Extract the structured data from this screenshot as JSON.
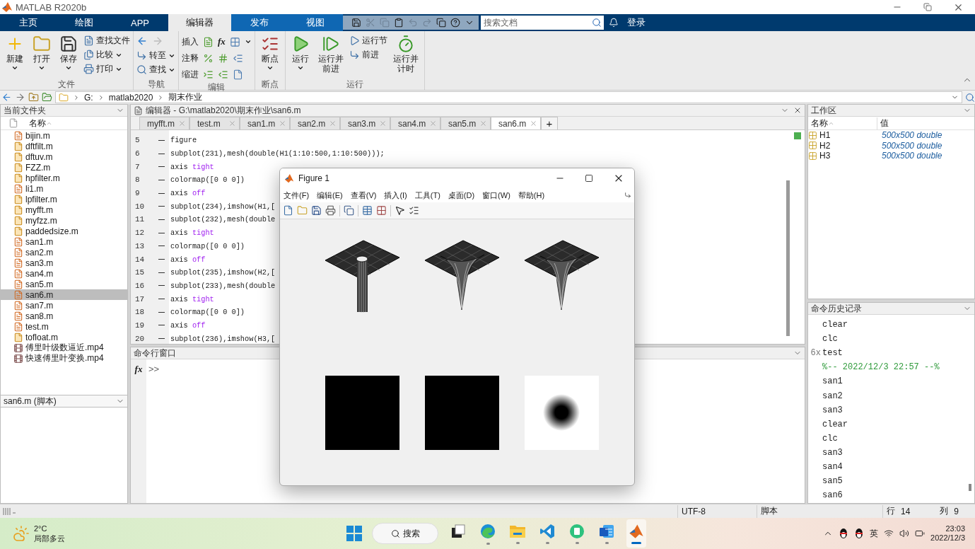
{
  "window": {
    "title": "MATLAB R2020b"
  },
  "ribbon_tabs": [
    {
      "label": "主页",
      "selected": false,
      "contextual": false
    },
    {
      "label": "绘图",
      "selected": false,
      "contextual": false
    },
    {
      "label": "APP",
      "selected": false,
      "contextual": false
    },
    {
      "label": "编辑器",
      "selected": true,
      "contextual": true
    },
    {
      "label": "发布",
      "selected": false,
      "contextual": true
    },
    {
      "label": "视图",
      "selected": false,
      "contextual": true
    }
  ],
  "quick_access": [
    {
      "enabled": true
    },
    {
      "enabled": false
    },
    {
      "enabled": false
    },
    {
      "enabled": true
    },
    {
      "enabled": false
    },
    {
      "enabled": false
    },
    {
      "enabled": true
    },
    {
      "enabled": true
    },
    {
      "enabled": true
    }
  ],
  "doc_search": {
    "placeholder": "搜索文档"
  },
  "sign_in": "登录",
  "ribbon_groups": [
    {
      "title": "文件",
      "items": [
        {
          "kind": "large",
          "label": "新建",
          "dropdown": true
        },
        {
          "kind": "large",
          "label": "打开",
          "dropdown": true
        },
        {
          "kind": "large",
          "label": "保存",
          "dropdown": true
        },
        {
          "kind": "stack",
          "buttons": [
            {
              "label": "查找文件",
              "dropdown": false
            },
            {
              "label": "比较",
              "dropdown": true
            },
            {
              "label": "打印",
              "dropdown": true
            }
          ]
        }
      ]
    },
    {
      "title": "导航",
      "items": [
        {
          "kind": "nav",
          "back_enabled": true,
          "forward_enabled": false,
          "buttons": [
            {
              "label": "转至",
              "dropdown": true
            },
            {
              "label": "查找",
              "dropdown": true
            }
          ]
        }
      ]
    },
    {
      "title": "编辑",
      "items": [
        {
          "kind": "edit_rows",
          "rows": [
            {
              "label": "插入",
              "function_button": "fx",
              "dropdown": true
            },
            {
              "label": "注释",
              "dropdown": false
            },
            {
              "label": "缩进",
              "dropdown": false
            }
          ]
        }
      ]
    },
    {
      "title": "断点",
      "items": [
        {
          "kind": "large",
          "label": "断点",
          "dropdown": true
        }
      ]
    },
    {
      "title": "运行",
      "items": [
        {
          "kind": "large",
          "label": "运行",
          "dropdown": true
        },
        {
          "kind": "large",
          "label": "运行并前进",
          "dropdown": false
        },
        {
          "kind": "stack",
          "buttons": [
            {
              "label": "运行节",
              "dropdown": false
            },
            {
              "label": "前进",
              "dropdown": false
            }
          ]
        },
        {
          "kind": "large",
          "label": "运行并计时",
          "dropdown": false
        }
      ]
    }
  ],
  "address": {
    "path": [
      "G:",
      "matlab2020",
      "期末作业"
    ]
  },
  "current_folder": {
    "title": "当前文件夹",
    "column": "名称",
    "files": [
      {
        "name": "bijin.m",
        "kind": "script",
        "selected": false
      },
      {
        "name": "dftfilt.m",
        "kind": "function",
        "selected": false
      },
      {
        "name": "dftuv.m",
        "kind": "function",
        "selected": false
      },
      {
        "name": "FZZ.m",
        "kind": "function",
        "selected": false
      },
      {
        "name": "hpfilter.m",
        "kind": "function",
        "selected": false
      },
      {
        "name": "li1.m",
        "kind": "script",
        "selected": false
      },
      {
        "name": "lpfilter.m",
        "kind": "function",
        "selected": false
      },
      {
        "name": "myfft.m",
        "kind": "function",
        "selected": false
      },
      {
        "name": "myfzz.m",
        "kind": "function",
        "selected": false
      },
      {
        "name": "paddedsize.m",
        "kind": "function",
        "selected": false
      },
      {
        "name": "san1.m",
        "kind": "script",
        "selected": false
      },
      {
        "name": "san2.m",
        "kind": "script",
        "selected": false
      },
      {
        "name": "san3.m",
        "kind": "script",
        "selected": false
      },
      {
        "name": "san4.m",
        "kind": "script",
        "selected": false
      },
      {
        "name": "san5.m",
        "kind": "script",
        "selected": false
      },
      {
        "name": "san6.m",
        "kind": "script",
        "selected": true
      },
      {
        "name": "san7.m",
        "kind": "script",
        "selected": false
      },
      {
        "name": "san8.m",
        "kind": "script",
        "selected": false
      },
      {
        "name": "test.m",
        "kind": "script",
        "selected": false
      },
      {
        "name": "tofloat.m",
        "kind": "function",
        "selected": false
      },
      {
        "name": "傅里叶级数逼近.mp4",
        "kind": "video",
        "selected": false
      },
      {
        "name": "快速傅里叶变换.mp4",
        "kind": "video",
        "selected": false
      }
    ],
    "details": "san6.m (脚本)"
  },
  "editor": {
    "title": "编辑器 - G:\\matlab2020\\期末作业\\san6.m",
    "tabs": [
      {
        "label": "myfft.m",
        "selected": false
      },
      {
        "label": "test.m",
        "selected": false
      },
      {
        "label": "san1.m",
        "selected": false
      },
      {
        "label": "san2.m",
        "selected": false
      },
      {
        "label": "san3.m",
        "selected": false
      },
      {
        "label": "san4.m",
        "selected": false
      },
      {
        "label": "san5.m",
        "selected": false
      },
      {
        "label": "san6.m",
        "selected": true
      }
    ],
    "new_tab": "+",
    "lines": [
      {
        "number": "5",
        "code": "figure"
      },
      {
        "number": "6",
        "code": "subplot(231),mesh(double(H1(1:10:500,1:10:500)));"
      },
      {
        "number": "7",
        "code": "axis",
        "keyword": "tight"
      },
      {
        "number": "8",
        "code": "colormap([0 0 0])"
      },
      {
        "number": "9",
        "code": "axis",
        "keyword": "off"
      },
      {
        "number": "10",
        "code": "subplot(234),imshow(H1,["
      },
      {
        "number": "11",
        "code": "subplot(232),mesh(double"
      },
      {
        "number": "12",
        "code": "axis",
        "keyword": "tight"
      },
      {
        "number": "13",
        "code": "colormap([0 0 0])"
      },
      {
        "number": "14",
        "code": "axis",
        "keyword": "off"
      },
      {
        "number": "15",
        "code": "subplot(235),imshow(H2,["
      },
      {
        "number": "16",
        "code": "subplot(233),mesh(double"
      },
      {
        "number": "17",
        "code": "axis",
        "keyword": "tight"
      },
      {
        "number": "18",
        "code": "colormap([0 0 0])"
      },
      {
        "number": "19",
        "code": "axis",
        "keyword": "off"
      },
      {
        "number": "20",
        "code": "subplot(236),imshow(H3,["
      }
    ]
  },
  "command_window": {
    "title": "命令行窗口",
    "function_button": "fx",
    "prompt": ">>"
  },
  "workspace": {
    "title": "工作区",
    "columns": [
      "名称",
      "值"
    ],
    "variables": [
      {
        "name": "H1",
        "value": "500x500 double"
      },
      {
        "name": "H2",
        "value": "500x500 double"
      },
      {
        "name": "H3",
        "value": "500x500 double"
      }
    ]
  },
  "history": {
    "title": "命令历史记录",
    "entries": [
      {
        "text": "clear",
        "kind": "command"
      },
      {
        "text": "clc",
        "kind": "command"
      },
      {
        "count": "6x",
        "text": "test",
        "kind": "command"
      },
      {
        "text": "%-- 2022/12/3 22:57 --%",
        "kind": "session"
      },
      {
        "text": "san1",
        "kind": "command"
      },
      {
        "text": "san2",
        "kind": "command"
      },
      {
        "text": "san3",
        "kind": "command"
      },
      {
        "text": "clear",
        "kind": "command"
      },
      {
        "text": "clc",
        "kind": "command"
      },
      {
        "text": "san3",
        "kind": "command"
      },
      {
        "text": "san4",
        "kind": "command"
      },
      {
        "text": "san5",
        "kind": "command"
      },
      {
        "text": "san6",
        "kind": "command"
      }
    ]
  },
  "status_bar": {
    "encoding": "UTF-8",
    "file_type": "脚本",
    "row_label": "行",
    "row": "14",
    "col_label": "列",
    "col": "9"
  },
  "figure": {
    "title": "Figure 1",
    "menu": [
      "文件(F)",
      "编辑(E)",
      "查看(V)",
      "插入(I)",
      "工具(T)",
      "桌面(D)",
      "窗口(W)",
      "帮助(H)"
    ],
    "plots": [
      {
        "kind": "mesh_column"
      },
      {
        "kind": "mesh_funnel"
      },
      {
        "kind": "mesh_funnel"
      },
      {
        "kind": "image_dark"
      },
      {
        "kind": "image_dark"
      },
      {
        "kind": "image_spot"
      }
    ]
  },
  "taskbar": {
    "weather": {
      "temperature": "2°C",
      "condition": "局部多云"
    },
    "search": "搜索",
    "apps": [
      {
        "kind": "taskview",
        "running": false,
        "active": false
      },
      {
        "kind": "edge",
        "running": true,
        "active": false
      },
      {
        "kind": "explorer",
        "running": true,
        "active": false
      },
      {
        "kind": "vscode",
        "running": true,
        "active": false
      },
      {
        "kind": "notes",
        "running": true,
        "active": false
      },
      {
        "kind": "word",
        "running": true,
        "active": false
      },
      {
        "kind": "matlab",
        "running": true,
        "active": true
      }
    ],
    "ime": "英",
    "time": "23:03",
    "date": "2022/12/3"
  }
}
